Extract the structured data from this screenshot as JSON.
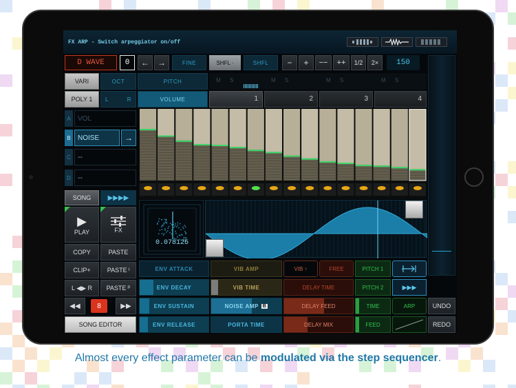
{
  "header": {
    "status": "FX ARP - Switch arpeggiator on/off"
  },
  "toolbar": {
    "instrument": "D WAVE",
    "instrument_number": "0",
    "fine": "FINE",
    "shuffle_1": "SHFL ·",
    "shuffle_2": "SHFL",
    "minus": "−",
    "plus": "+",
    "minus_minus": "−−",
    "plus_plus": "++",
    "half": "1/2",
    "double": "2×",
    "tempo": "150"
  },
  "row2": {
    "vari": "VARI",
    "oct": "OCT",
    "pitch": "PITCH",
    "tabs_m": "M",
    "tabs_s": "S"
  },
  "row3": {
    "poly": "POLY 1",
    "l": "L",
    "r": "R",
    "volume": "VOLUME",
    "pattern_tabs": [
      "1",
      "2",
      "3",
      "4"
    ]
  },
  "tracks": [
    {
      "letter": "A",
      "name": "VOL"
    },
    {
      "letter": "B",
      "name": "NOISE"
    },
    {
      "letter": "C",
      "name": "--"
    },
    {
      "letter": "D",
      "name": "--"
    }
  ],
  "left_buttons": {
    "song": "SONG",
    "play": "PLAY",
    "fx": "FX",
    "copy": "COPY",
    "paste": "PASTE",
    "clip": "CLIP+",
    "paste_i": "PASTE",
    "paste_i_sub": "I",
    "lr": "L ◀▶ R",
    "paste_p": "PASTE",
    "paste_p_sub": "P",
    "counter": "8",
    "song_editor": "SONG EDITOR"
  },
  "display": {
    "value": "0.078125"
  },
  "params": {
    "env_attack": "ENV ATTACK",
    "env_decay": "ENV DECAY",
    "env_sustain": "ENV SUSTAIN",
    "env_release": "ENV RELEASE",
    "vib_amp": "VIB AMP",
    "vib_time": "VIB TIME",
    "noise_amp": "NOISE AMP",
    "noise_badge": "B",
    "porta_time": "PORTA TIME",
    "vib_up": "VIB ↑",
    "free": "FREE",
    "delay_time": "DELAY TIME",
    "delay_feed": "DELAY FEED",
    "delay_mix": "DELAY MIX",
    "pitch1": "PITCH 1",
    "pitch2": "PITCH 2",
    "time": "TIME",
    "feed": "FEED",
    "arp": "ARP",
    "undo": "UNDO",
    "redo": "REDO"
  },
  "sequencer": {
    "step_levels": [
      0.72,
      0.63,
      0.56,
      0.51,
      0.5,
      0.47,
      0.43,
      0.4,
      0.35,
      0.31,
      0.27,
      0.25,
      0.22,
      0.21,
      0.19,
      0.16
    ],
    "active_step": 6
  },
  "caption": {
    "plain_start": "Almost every effect parameter can be ",
    "bold": "modulated via the step sequencer",
    "plain_end": "."
  }
}
